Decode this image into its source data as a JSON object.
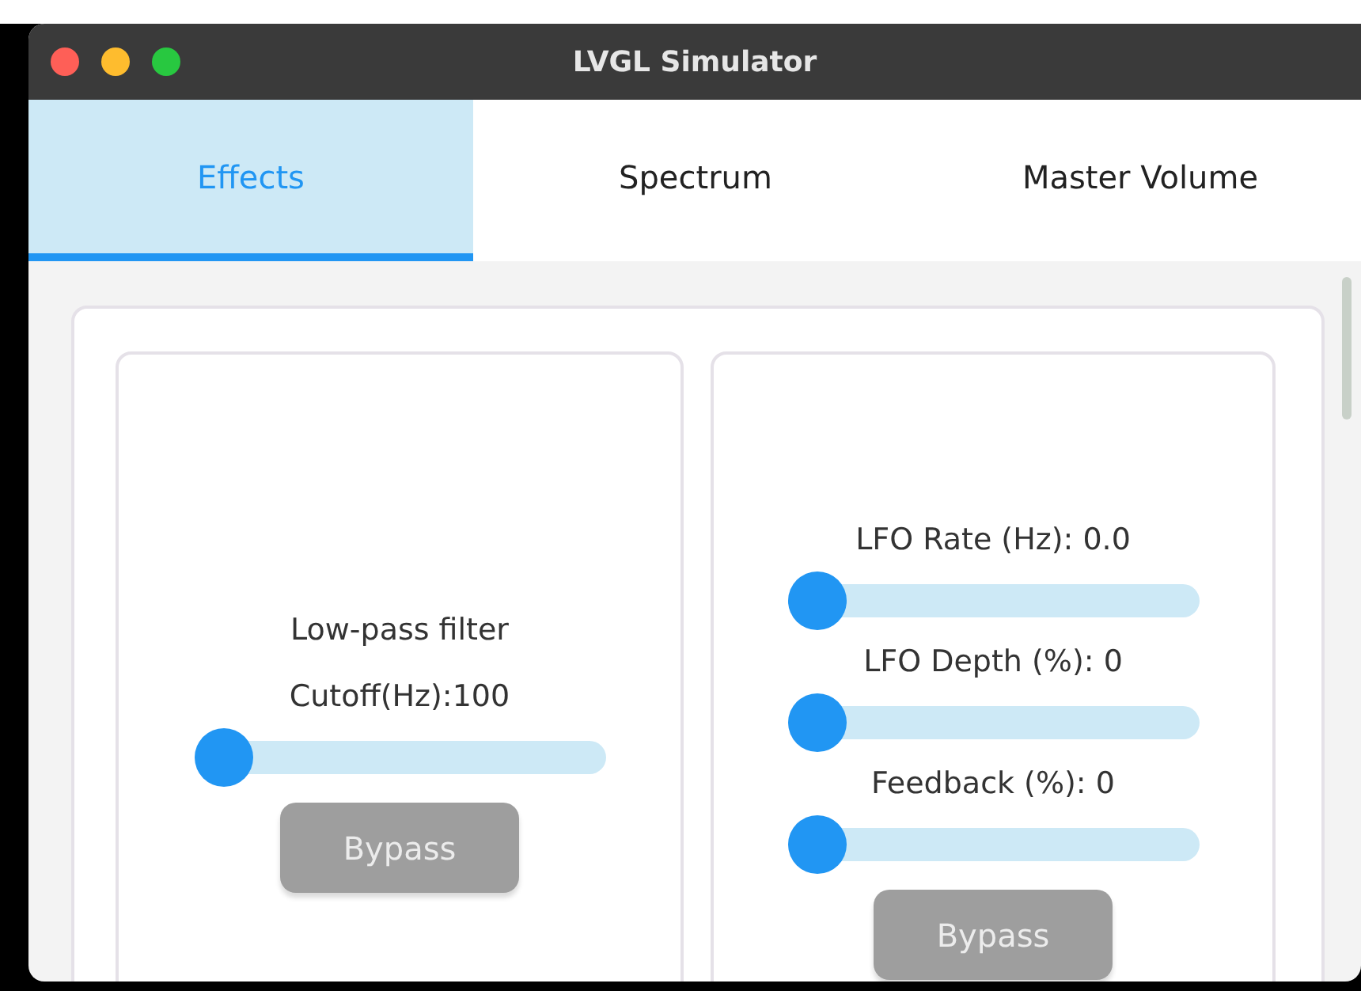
{
  "window": {
    "title": "LVGL Simulator"
  },
  "tabs": [
    {
      "label": "Effects",
      "selected": true
    },
    {
      "label": "Spectrum",
      "selected": false
    },
    {
      "label": "Master Volume",
      "selected": false
    }
  ],
  "panels": [
    {
      "items": [
        {
          "kind": "label",
          "text": "Low-pass filter"
        },
        {
          "kind": "label",
          "text": "Cutoff(Hz):100"
        },
        {
          "kind": "slider",
          "level": 0
        },
        {
          "kind": "button",
          "label": "Bypass",
          "disabled": true
        }
      ]
    },
    {
      "items": [
        {
          "kind": "label",
          "text": "LFO Rate (Hz): 0.0"
        },
        {
          "kind": "slider",
          "level": 0
        },
        {
          "kind": "label",
          "text": "LFO Depth (%): 0"
        },
        {
          "kind": "slider",
          "level": 0
        },
        {
          "kind": "label",
          "text": "Feedback (%): 0"
        },
        {
          "kind": "slider",
          "level": 0
        },
        {
          "kind": "button",
          "label": "Bypass",
          "disabled": true
        }
      ]
    }
  ]
}
